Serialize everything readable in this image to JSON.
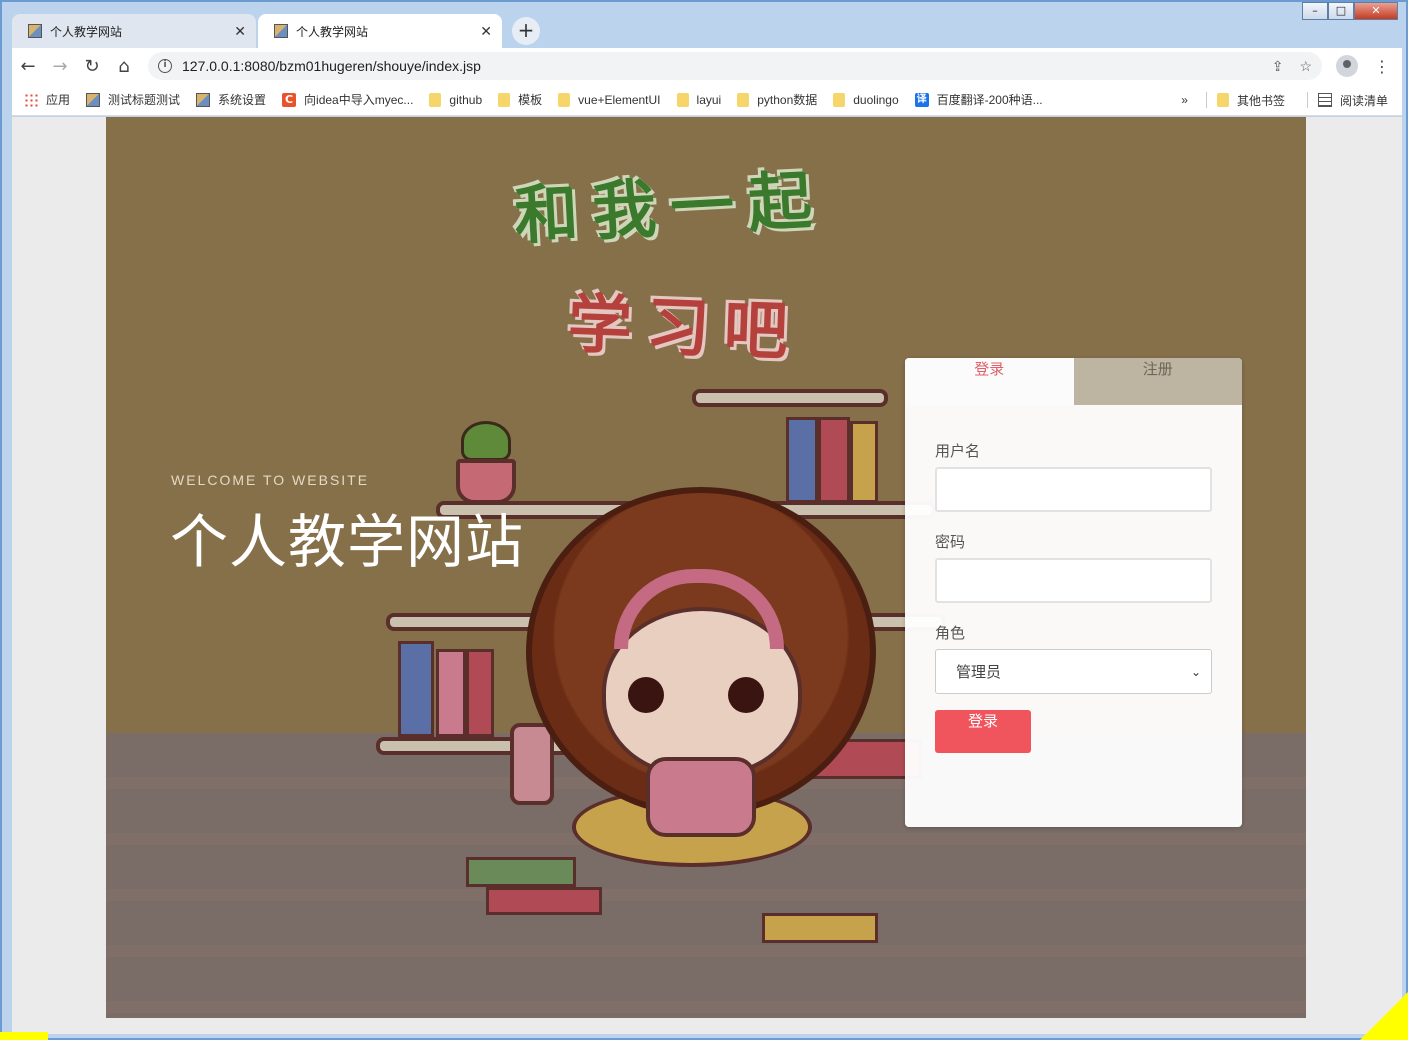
{
  "browser": {
    "tabs": [
      {
        "title": "个人教学网站",
        "active": false
      },
      {
        "title": "个人教学网站",
        "active": true
      }
    ],
    "url": "127.0.0.1:8080/bzm01hugeren/shouye/index.jsp",
    "bookmarks": [
      {
        "label": "应用",
        "icon": "apps-grid-icon"
      },
      {
        "label": "测试标题测试",
        "icon": "page-icon"
      },
      {
        "label": "系统设置",
        "icon": "page-icon"
      },
      {
        "label": "向idea中导入myec...",
        "icon": "csdn-icon"
      },
      {
        "label": "github",
        "icon": "folder-icon"
      },
      {
        "label": "模板",
        "icon": "folder-icon"
      },
      {
        "label": "vue+ElementUI",
        "icon": "folder-icon"
      },
      {
        "label": "layui",
        "icon": "folder-icon"
      },
      {
        "label": "python数据",
        "icon": "folder-icon"
      },
      {
        "label": "duolingo",
        "icon": "folder-icon"
      },
      {
        "label": "百度翻译-200种语...",
        "icon": "translate-icon"
      }
    ],
    "overflow_label": "»",
    "other_bookmarks": "其他书签",
    "reading_list": "阅读清单"
  },
  "hero": {
    "headline_1": "和我一起",
    "headline_2": "学习吧",
    "welcome": "WELCOME TO WEBSITE",
    "site_title": "个人教学网站"
  },
  "login": {
    "tab_login": "登录",
    "tab_register": "注册",
    "username_label": "用户名",
    "username_value": "",
    "password_label": "密码",
    "password_value": "",
    "role_label": "角色",
    "role_selected": "管理员",
    "submit_label": "登录"
  },
  "colors": {
    "accent": "#f0545d",
    "tab_active_text": "#e25f6a",
    "tab_inactive_bg": "#bdb4a1",
    "hero_bg": "#85704a"
  }
}
